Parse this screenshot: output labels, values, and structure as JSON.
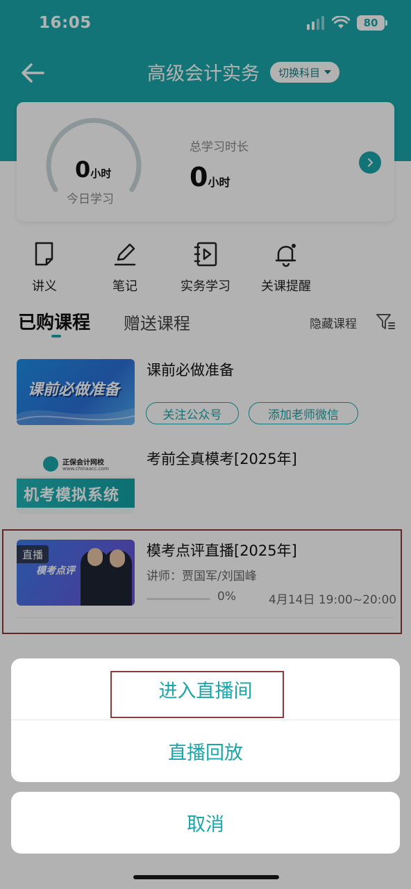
{
  "status_bar": {
    "time": "16:05",
    "battery": "80"
  },
  "nav": {
    "title": "高级会计实务",
    "switch_label": "切换科目"
  },
  "stats": {
    "today_value": "0",
    "today_unit": "小时",
    "today_label": "今日学习",
    "total_label": "总学习时长",
    "total_value": "0",
    "total_unit": "小时"
  },
  "quick_menu": [
    {
      "label": "讲义",
      "icon": "handout-icon"
    },
    {
      "label": "笔记",
      "icon": "pen-icon"
    },
    {
      "label": "实务学习",
      "icon": "video-book-icon"
    },
    {
      "label": "关课提醒",
      "icon": "bell-icon"
    }
  ],
  "tabs": {
    "active": "已购课程",
    "gift": "赠送课程",
    "hide": "隐藏课程"
  },
  "courses": [
    {
      "title": "课前必做准备",
      "thumb_text": "课前必做准备",
      "buttons": [
        "关注公众号",
        "添加老师微信"
      ]
    },
    {
      "title": "考前全真模考[2025年]",
      "thumb_brand": "正保会计网校",
      "thumb_url": "www.chinaacc.com",
      "thumb_text": "机考模拟系统"
    },
    {
      "title": "模考点评直播[2025年]",
      "badge": "直播",
      "thumb_text": "模考点评",
      "teacher": "讲师：贾国军/刘国峰",
      "progress": 0,
      "progress_text": "0%",
      "schedule": "4月14日 19:00~20:00"
    }
  ],
  "action_sheet": {
    "enter_live": "进入直播间",
    "replay": "直播回放",
    "cancel": "取消"
  },
  "colors": {
    "accent": "#1aa6a9",
    "highlight": "#8b3a3a"
  }
}
